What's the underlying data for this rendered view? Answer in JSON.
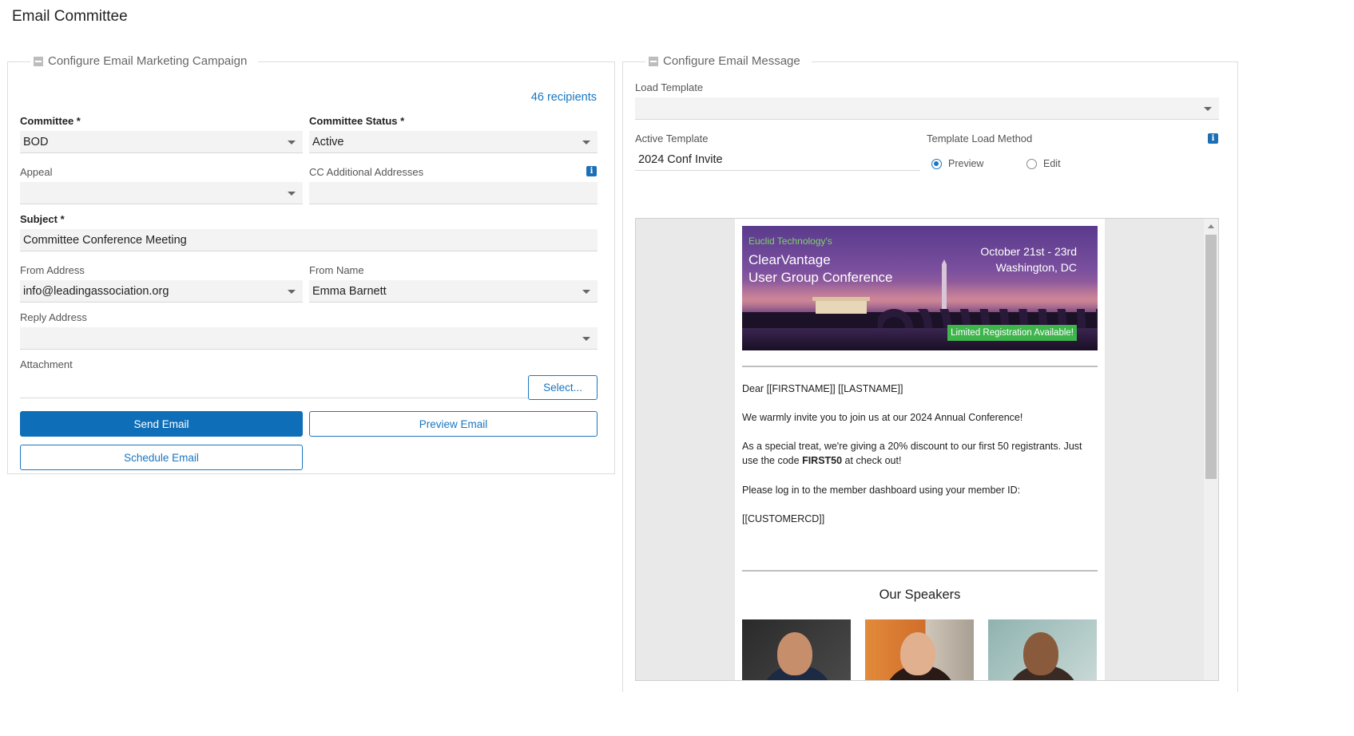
{
  "page": {
    "title": "Email Committee"
  },
  "left": {
    "legend": "Configure Email Marketing Campaign",
    "recipients": "46 recipients",
    "committee": {
      "label": "Committee *",
      "value": "BOD"
    },
    "committee_status": {
      "label": "Committee Status *",
      "value": "Active"
    },
    "appeal": {
      "label": "Appeal",
      "value": ""
    },
    "cc": {
      "label": "CC Additional Addresses",
      "value": ""
    },
    "subject": {
      "label": "Subject *",
      "value": "Committee Conference Meeting"
    },
    "from_address": {
      "label": "From Address",
      "value": "info@leadingassociation.org"
    },
    "from_name": {
      "label": "From Name",
      "value": "Emma Barnett"
    },
    "reply_address": {
      "label": "Reply Address",
      "value": ""
    },
    "attachment": {
      "label": "Attachment",
      "value": "",
      "select_label": "Select..."
    },
    "send_label": "Send Email",
    "preview_label": "Preview Email",
    "schedule_label": "Schedule Email"
  },
  "right": {
    "legend": "Configure Email Message",
    "load_template": {
      "label": "Load Template",
      "value": ""
    },
    "active_template": {
      "label": "Active Template",
      "value": "2024 Conf Invite"
    },
    "template_load_method": {
      "label": "Template Load Method",
      "options": [
        "Preview",
        "Edit"
      ],
      "selected": "Preview"
    }
  },
  "email": {
    "banner": {
      "brand": "Euclid Technology's",
      "title_line1": "ClearVantage",
      "title_line2": "User Group Conference",
      "date_line1": "October 21st - 23rd",
      "date_line2": "Washington, DC",
      "badge": "Limited Registration Available!"
    },
    "greeting": "Dear [[FIRSTNAME]] [[LASTNAME]]",
    "para1": "We warmly invite you to join us at our 2024 Annual Conference!",
    "para2_pre": "As a special treat, we're giving a 20% discount to our first 50 registrants. Just use the code ",
    "para2_code": "FIRST50",
    "para2_post": " at check out!",
    "para3": "Please log in to the member dashboard using your member ID:",
    "para4": "[[CUSTOMERCD]]",
    "speakers_title": "Our Speakers"
  },
  "colors": {
    "accent": "#0e6fb8",
    "badge_green": "#3cb54a",
    "brand_green": "#7ed36a"
  }
}
